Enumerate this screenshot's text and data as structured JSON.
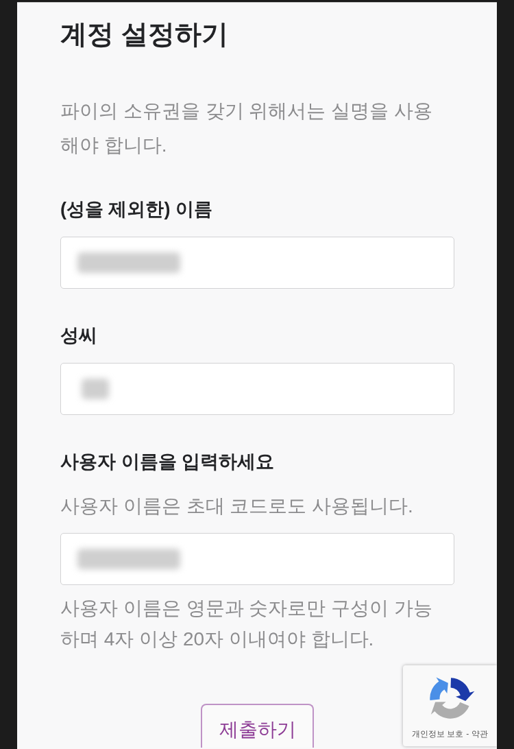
{
  "title": "계정 설정하기",
  "intro": "파이의 소유권을 갖기 위해서는 실명을 사용해야 합니다.",
  "fields": [
    {
      "label": "(성을 제외한) 이름",
      "value_blurred": true
    },
    {
      "label": "성씨",
      "value_blurred": true
    },
    {
      "label": "사용자 이름을 입력하세요",
      "hint": "사용자 이름은 초대 코드로도 사용됩니다.",
      "value_blurred": true,
      "note": "사용자 이름은 영문과 숫자로만 구성이 가능하며 4자 이상 20자 이내여야 합니다."
    }
  ],
  "submit": {
    "label": "제출하기"
  },
  "captcha_badge": {
    "privacy_link": "개인정보 보호",
    "separator": "-",
    "terms_link": "약관"
  }
}
